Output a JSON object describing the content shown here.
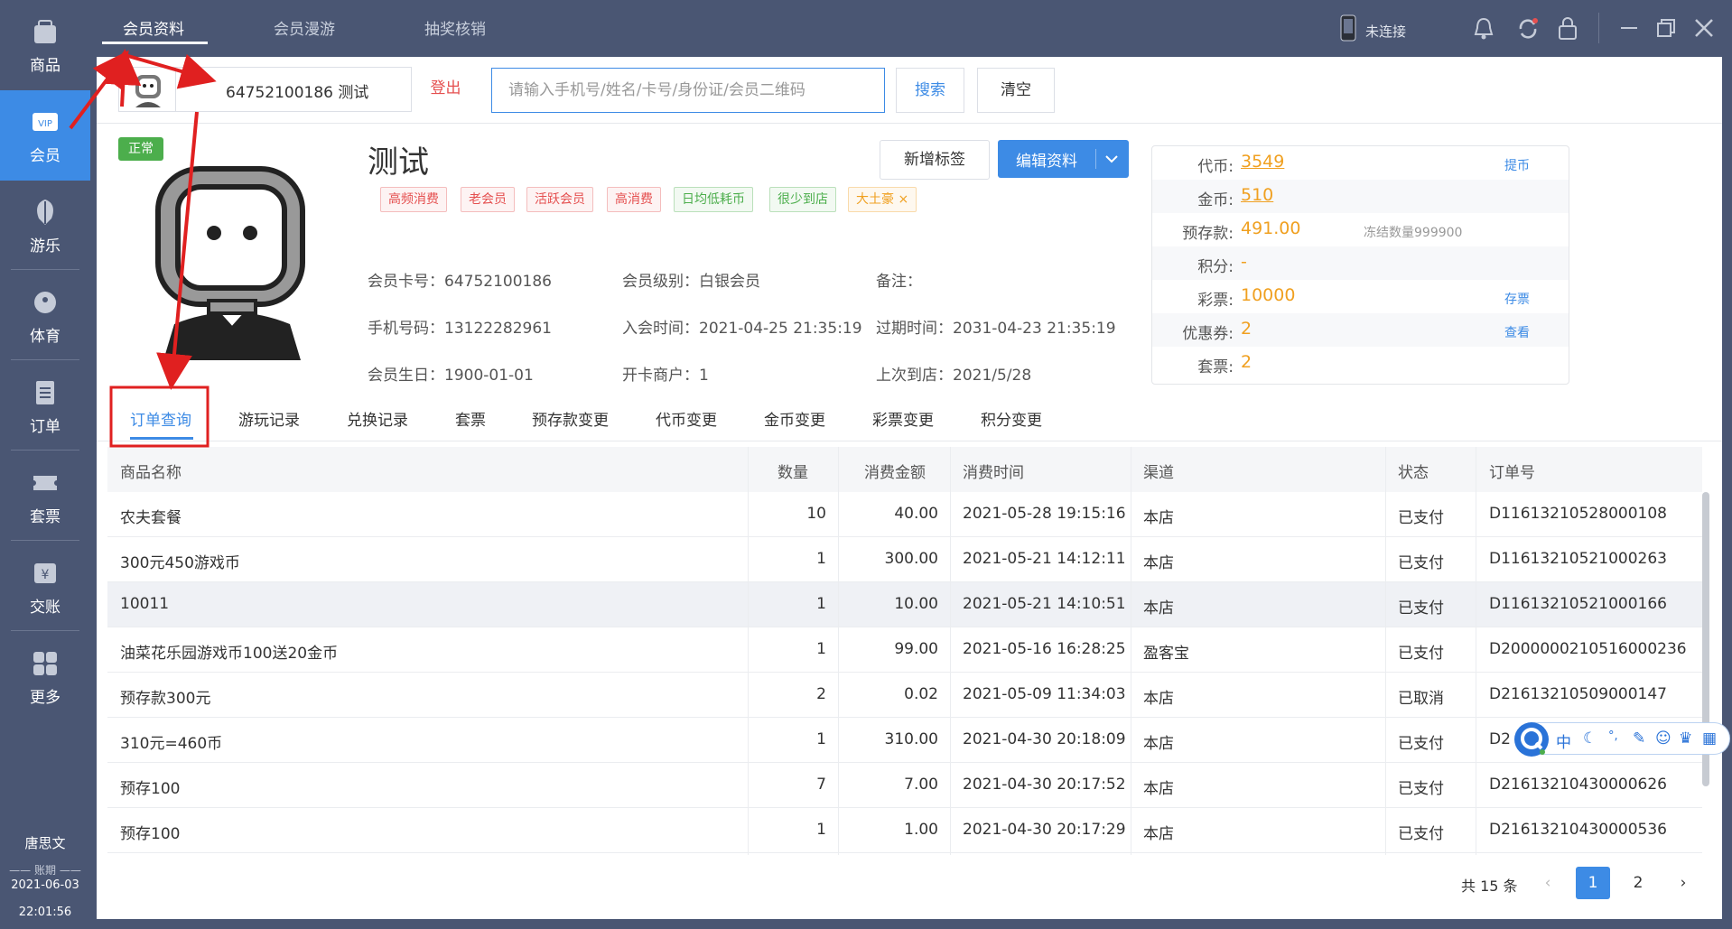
{
  "sidebar": {
    "items": [
      {
        "label": "商品",
        "icon": "goods-icon"
      },
      {
        "label": "会员",
        "icon": "vip-icon"
      },
      {
        "label": "游乐",
        "icon": "ride-icon"
      },
      {
        "label": "体育",
        "icon": "sports-icon"
      },
      {
        "label": "订单",
        "icon": "order-icon"
      },
      {
        "label": "套票",
        "icon": "ticket-icon"
      },
      {
        "label": "交账",
        "icon": "cash-icon"
      },
      {
        "label": "更多",
        "icon": "more-icon"
      }
    ],
    "user": "唐思文",
    "shift_label": "账期",
    "date": "2021-06-03",
    "time": "22:01:56"
  },
  "topbar": {
    "tabs": [
      "会员资料",
      "会员漫游",
      "抽奖核销"
    ],
    "connection": "未连接"
  },
  "member": {
    "card_display": "64752100186  测试",
    "logout": "登出",
    "search_placeholder": "请输入手机号/姓名/卡号/身份证/会员二维码",
    "search": "搜索",
    "clear": "清空",
    "status": "正常",
    "name": "测试",
    "add_tag": "新增标签",
    "edit": "编辑资料",
    "tags": [
      {
        "text": "高频消费",
        "color": "#e55050"
      },
      {
        "text": "老会员",
        "color": "#e55050"
      },
      {
        "text": "活跃会员",
        "color": "#e55050"
      },
      {
        "text": "高消费",
        "color": "#e55050"
      },
      {
        "text": "日均低耗币",
        "color": "#4cae4c"
      },
      {
        "text": "很少到店",
        "color": "#4cae4c"
      },
      {
        "text": "大土豪",
        "color": "#f0a020"
      }
    ],
    "info": {
      "card_no": "会员卡号：64752100186",
      "level": "会员级别：白银会员",
      "remark": "备注：",
      "phone": "手机号码：13122282961",
      "join_time": "入会时间：2021-04-25 21:35:19",
      "expire_time": "过期时间：2031-04-23 21:35:19",
      "birthday": "会员生日：1900-01-01",
      "merchant": "开卡商户：1",
      "last_visit": "上次到店：2021/5/28"
    }
  },
  "balance": {
    "rows": [
      {
        "label": "代币:",
        "value": "3549",
        "link": "提币"
      },
      {
        "label": "金币:",
        "value": "510",
        "link": ""
      },
      {
        "label": "预存款:",
        "value": "491.00",
        "note": "冻结数量999900",
        "link": ""
      },
      {
        "label": "积分:",
        "value": "-",
        "link": ""
      },
      {
        "label": "彩票:",
        "value": "10000",
        "link": "存票"
      },
      {
        "label": "优惠券:",
        "value": "2",
        "link": "查看"
      },
      {
        "label": "套票:",
        "value": "2",
        "link": ""
      }
    ]
  },
  "subtabs": [
    "订单查询",
    "游玩记录",
    "兑换记录",
    "套票",
    "预存款变更",
    "代币变更",
    "金币变更",
    "彩票变更",
    "积分变更"
  ],
  "table": {
    "headers": [
      "商品名称",
      "数量",
      "消费金额",
      "消费时间",
      "渠道",
      "状态",
      "订单号"
    ],
    "rows": [
      [
        "农夫套餐",
        "10",
        "40.00",
        "2021-05-28 19:15:16",
        "本店",
        "已支付",
        "D11613210528000108"
      ],
      [
        "300元450游戏币",
        "1",
        "300.00",
        "2021-05-21 14:12:11",
        "本店",
        "已支付",
        "D11613210521000263"
      ],
      [
        "10011",
        "1",
        "10.00",
        "2021-05-21 14:10:51",
        "本店",
        "已支付",
        "D11613210521000166"
      ],
      [
        "油菜花乐园游戏币100送20金币",
        "1",
        "99.00",
        "2021-05-16 16:28:25",
        "盈客宝",
        "已支付",
        "D2000000210516000236"
      ],
      [
        "预存款300元",
        "2",
        "0.02",
        "2021-05-09 11:34:03",
        "本店",
        "已取消",
        "D21613210509000147"
      ],
      [
        "310元=460币",
        "1",
        "310.00",
        "2021-04-30 20:18:09",
        "本店",
        "已支付",
        "D2"
      ],
      [
        "预存100",
        "7",
        "7.00",
        "2021-04-30 20:17:52",
        "本店",
        "已支付",
        "D21613210430000626"
      ],
      [
        "预存100",
        "1",
        "1.00",
        "2021-04-30 20:17:29",
        "本店",
        "已支付",
        "D21613210430000536"
      ]
    ]
  },
  "pager": {
    "total": "共 15 条",
    "pages": [
      "1",
      "2"
    ]
  },
  "ime": {
    "mode": "中"
  }
}
